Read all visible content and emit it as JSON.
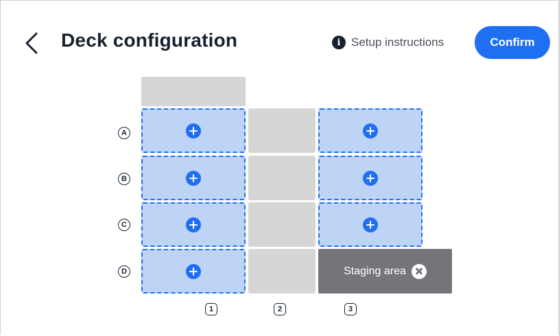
{
  "header": {
    "title": "Deck configuration",
    "back_icon": "chevron-left-icon",
    "setup_instructions_label": "Setup instructions",
    "setup_icon": "info-icon",
    "confirm_label": "Confirm"
  },
  "colors": {
    "accent": "#1f6ff2",
    "slot_fill": "#bed4f7",
    "empty_slot": "#d6d6d6",
    "staging_fill": "#74757b",
    "text_dark": "#16212d"
  },
  "deck": {
    "rows": [
      "A",
      "B",
      "C",
      "D"
    ],
    "columns": [
      "1",
      "2",
      "3"
    ],
    "slots": [
      {
        "row": "A",
        "col": "1",
        "state": "add"
      },
      {
        "row": "A",
        "col": "2",
        "state": "empty"
      },
      {
        "row": "A",
        "col": "3",
        "state": "add"
      },
      {
        "row": "B",
        "col": "1",
        "state": "add"
      },
      {
        "row": "B",
        "col": "2",
        "state": "empty"
      },
      {
        "row": "B",
        "col": "3",
        "state": "add"
      },
      {
        "row": "C",
        "col": "1",
        "state": "add"
      },
      {
        "row": "C",
        "col": "2",
        "state": "empty"
      },
      {
        "row": "C",
        "col": "3",
        "state": "add"
      },
      {
        "row": "D",
        "col": "1",
        "state": "add"
      },
      {
        "row": "D",
        "col": "2",
        "state": "empty"
      }
    ],
    "staging_label": "Staging area",
    "staging_icon": "close-icon",
    "slot_icon": "plus-icon"
  }
}
